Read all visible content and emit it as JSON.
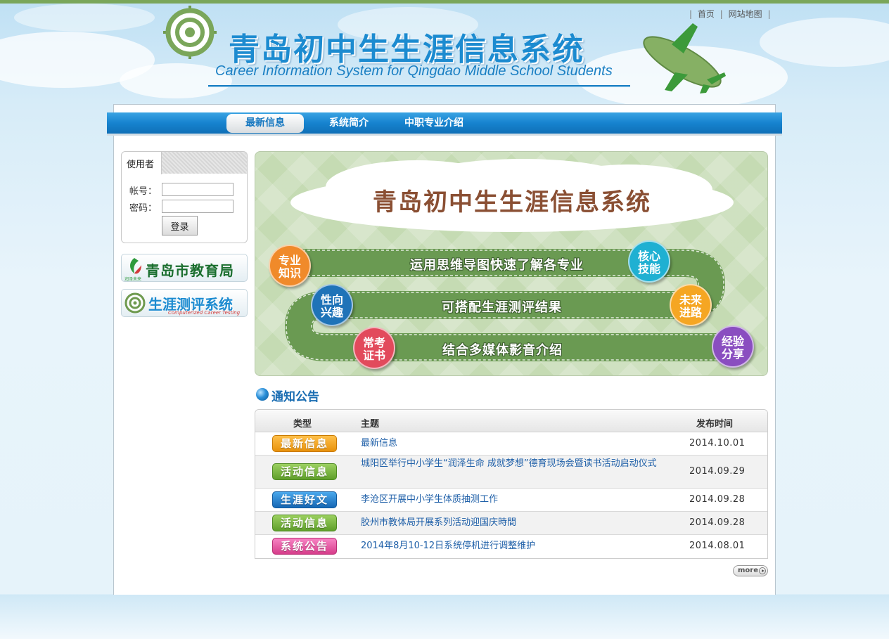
{
  "header": {
    "title": "青岛初中生生涯信息系统",
    "subtitle": "Career Information System for Qingdao Middle School Students",
    "top_links": [
      "首页",
      "网站地图"
    ],
    "separator": "|"
  },
  "nav": {
    "items": [
      {
        "label": "最新信息",
        "active": true
      },
      {
        "label": "系统简介",
        "active": false
      },
      {
        "label": "中职专业介绍",
        "active": false
      }
    ]
  },
  "login": {
    "tab_label": "使用者",
    "account_label": "帐号：",
    "password_label": "密码：",
    "account_value": "",
    "password_value": "",
    "submit_label": "登录"
  },
  "side_banners": [
    {
      "title": "青岛市教育局",
      "caption": "润泽未来",
      "icon": "qingdao-education-logo-icon"
    },
    {
      "title": "生涯测评系统",
      "caption": "Computerized Career Testing",
      "icon": "target-icon"
    }
  ],
  "hero": {
    "title": "青岛初中生生涯信息系统",
    "roads": [
      "运用思维导图快速了解各专业",
      "可搭配生涯测评结果",
      "结合多媒体影音介绍"
    ],
    "bubbles": [
      {
        "label": "专业知识",
        "color": "#f08a2a"
      },
      {
        "label": "核心技能",
        "color": "#1fb0d2"
      },
      {
        "label": "性向兴趣",
        "color": "#1f73b8"
      },
      {
        "label": "未来进路",
        "color": "#f5a623"
      },
      {
        "label": "常考证书",
        "color": "#e24a5c"
      },
      {
        "label": "经验分享",
        "color": "#8a4ec0"
      }
    ]
  },
  "notices": {
    "heading": "通知公告",
    "columns": [
      "类型",
      "主题",
      "发布时间"
    ],
    "rows": [
      {
        "type": "最新信息",
        "type_color": "#f0a020",
        "subject": "最新信息",
        "date": "2014.10.01"
      },
      {
        "type": "活动信息",
        "type_color": "#72b33a",
        "subject": "城阳区举行中小学生“润泽生命 成就梦想”德育现场会暨读书活动启动仪式",
        "date": "2014.09.29"
      },
      {
        "type": "生涯好文",
        "type_color": "#1f78c8",
        "subject": "李沧区开展中小学生体质抽测工作",
        "date": "2014.09.28"
      },
      {
        "type": "活动信息",
        "type_color": "#72b33a",
        "subject": "胶州市教体局开展系列活动迎国庆時間",
        "date": "2014.09.28"
      },
      {
        "type": "系统公告",
        "type_color": "#e0509a",
        "subject": "2014年8月10-12日系统停机进行调整维护",
        "date": "2014.08.01"
      }
    ],
    "more_label": "more"
  }
}
